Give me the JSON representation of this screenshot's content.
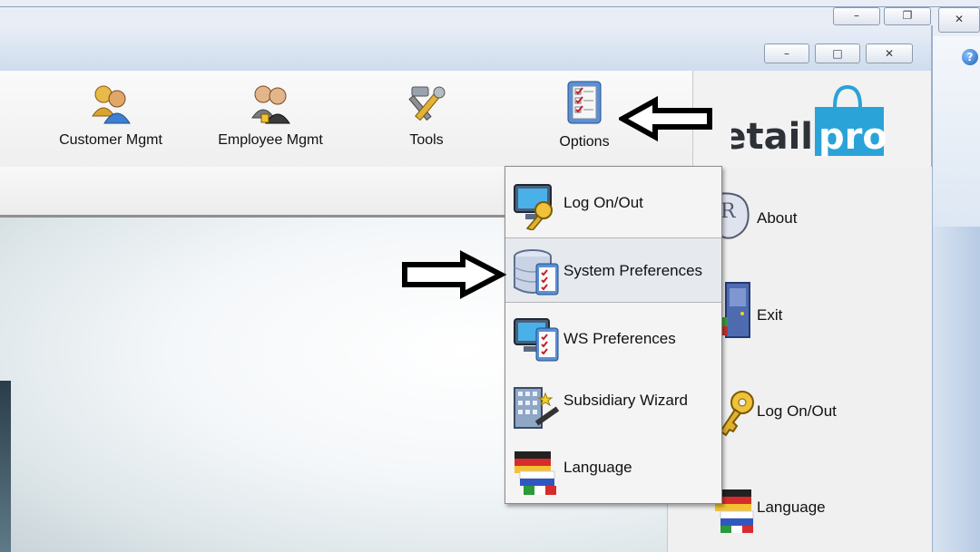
{
  "outer_window": {
    "controls": {
      "minimize": "–",
      "restore": "❐",
      "close": "✕"
    },
    "help_icon": "?"
  },
  "inner_window": {
    "controls": {
      "minimize": "–",
      "maximize": "□",
      "close": "✕"
    }
  },
  "ribbon": {
    "buttons": [
      {
        "label": "Customer Mgmt",
        "icon": "customer-mgmt-icon"
      },
      {
        "label": "Employee Mgmt",
        "icon": "employee-mgmt-icon"
      },
      {
        "label": "Tools",
        "icon": "tools-icon"
      },
      {
        "label": "Options",
        "icon": "options-checklist-icon"
      }
    ]
  },
  "logo": {
    "text_dark": "retail",
    "text_light": "pro"
  },
  "options_menu": {
    "items": [
      {
        "label": "Log On/Out",
        "icon": "computer-key-icon"
      },
      {
        "label": "System Preferences",
        "icon": "database-checklist-icon"
      },
      {
        "label": "WS Preferences",
        "icon": "monitor-checklist-icon"
      },
      {
        "label": "Subsidiary Wizard",
        "icon": "building-wand-icon"
      },
      {
        "label": "Language",
        "icon": "flags-icon"
      }
    ]
  },
  "right_panel": {
    "items": [
      {
        "label": "About",
        "icon": "about-icon"
      },
      {
        "label": "Exit",
        "icon": "exit-door-icon"
      },
      {
        "label": "Log On/Out",
        "icon": "key-icon"
      },
      {
        "label": "Language",
        "icon": "flags-icon"
      }
    ]
  },
  "colors": {
    "logo_dark": "#2d3138",
    "logo_accent": "#2aa3d9",
    "arrow": "#000000"
  }
}
